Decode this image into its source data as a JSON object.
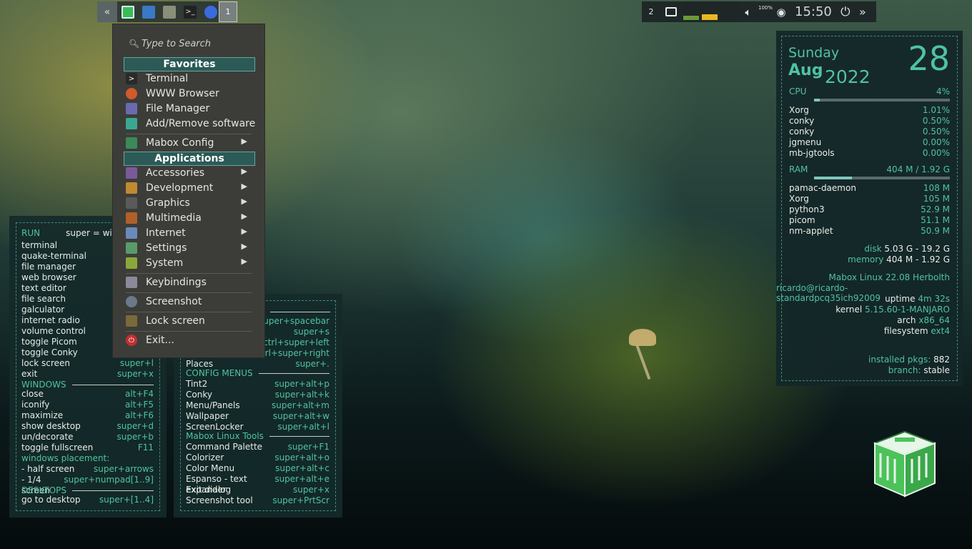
{
  "panel_left": {
    "workspace": "1"
  },
  "panel_right": {
    "desktop_num": "2",
    "volume": "100%",
    "clock": "15:50"
  },
  "menu": {
    "search_placeholder": "Type to Search",
    "favorites_header": "Favorites",
    "favorites": [
      "Terminal",
      "WWW Browser",
      "File Manager",
      "Add/Remove software"
    ],
    "mabox_config": "Mabox Config",
    "applications_header": "Applications",
    "applications": [
      "Accessories",
      "Development",
      "Graphics",
      "Multimedia",
      "Internet",
      "Settings",
      "System"
    ],
    "keybindings": "Keybindings",
    "screenshot": "Screenshot",
    "lock": "Lock screen",
    "exit": "Exit..."
  },
  "left_box": {
    "run": "RUN",
    "super_note": "super = wi",
    "items": [
      {
        "label": "terminal",
        "key": ""
      },
      {
        "label": "quake-terminal",
        "key": ""
      },
      {
        "label": "file manager",
        "key": ""
      },
      {
        "label": "web browser",
        "key": ""
      },
      {
        "label": "text editor",
        "key": ""
      },
      {
        "label": "file search",
        "key": ""
      },
      {
        "label": "galculator",
        "key": ""
      },
      {
        "label": "internet radio",
        "key": ""
      },
      {
        "label": "volume control",
        "key": ""
      },
      {
        "label": "toggle Picom",
        "key": ""
      },
      {
        "label": "toggle Conky",
        "key": ""
      },
      {
        "label": "lock screen",
        "key": "super+l"
      },
      {
        "label": "exit",
        "key": "super+x"
      }
    ],
    "windows": "WINDOWS",
    "win_items": [
      {
        "label": "close",
        "key": "alt+F4"
      },
      {
        "label": "iconify",
        "key": "alt+F5"
      },
      {
        "label": "maximize",
        "key": "alt+F6"
      },
      {
        "label": "show desktop",
        "key": "super+d"
      },
      {
        "label": "un/decorate",
        "key": "super+b"
      },
      {
        "label": "toggle fullscreen",
        "key": "F11"
      }
    ],
    "placement": "windows placement:",
    "place_items": [
      {
        "label": " - half screen",
        "key": "super+arrows"
      },
      {
        "label": " - 1/4 screen",
        "key": "super+numpad[1..9]"
      }
    ],
    "desktops": "DESKTOPS",
    "desk_items": [
      {
        "label": "go to desktop",
        "key": "super+[1..4]"
      }
    ]
  },
  "mid_box": {
    "top_items": [
      {
        "label": "",
        "key": "super+spacebar"
      },
      {
        "label": "",
        "key": "super+s"
      },
      {
        "label": "",
        "key": "ctrl+super+left"
      },
      {
        "label": "",
        "key": "ctrl+super+right"
      },
      {
        "label": "Places",
        "key": "super+."
      }
    ],
    "config": "CONFIG MENUS",
    "config_items": [
      {
        "label": "Tint2",
        "key": "super+alt+p"
      },
      {
        "label": "Conky",
        "key": "super+alt+k"
      },
      {
        "label": "Menu/Panels",
        "key": "super+alt+m"
      },
      {
        "label": "Wallpaper",
        "key": "super+alt+w"
      },
      {
        "label": "ScreenLocker",
        "key": "super+alt+l"
      }
    ],
    "tools": "Mabox Linux Tools",
    "tool_items": [
      {
        "label": "Command Palette",
        "key": "super+F1"
      },
      {
        "label": "Colorizer",
        "key": "super+alt+o"
      },
      {
        "label": "Color Menu",
        "key": "super+alt+c"
      },
      {
        "label": "Espanso - text expander",
        "key": "super+alt+e"
      },
      {
        "label": "Exit dialog",
        "key": "super+x"
      },
      {
        "label": "Screenshot tool",
        "key": "super+PrtScr"
      }
    ]
  },
  "conky": {
    "day": "Sunday",
    "month": "Aug",
    "year": "2022",
    "date": "28",
    "cpu_label": "CPU",
    "cpu_val": "4%",
    "cpu_frac": 0.04,
    "cpu_procs": [
      {
        "n": "Xorg",
        "v": "1.01%"
      },
      {
        "n": "conky",
        "v": "0.50%"
      },
      {
        "n": "conky",
        "v": "0.50%"
      },
      {
        "n": "jgmenu",
        "v": "0.00%"
      },
      {
        "n": "mb-jgtools",
        "v": "0.00%"
      }
    ],
    "ram_label": "RAM",
    "ram_val": "404 M / 1.92 G",
    "ram_frac": 0.28,
    "ram_procs": [
      {
        "n": "pamac-daemon",
        "v": "108 M"
      },
      {
        "n": "Xorg",
        "v": "105 M"
      },
      {
        "n": "python3",
        "v": "52.9 M"
      },
      {
        "n": "picom",
        "v": "51.1 M"
      },
      {
        "n": "nm-applet",
        "v": "50.9 M"
      }
    ],
    "disk_label": "disk",
    "disk_val": "5.03 G - 19.2 G",
    "mem_label": "memory",
    "mem_val": "404 M - 1.92 G",
    "distro": "Mabox Linux 22.08 Herbolth",
    "host": "ricardo@ricardo-standardpcq35ich92009",
    "uptime_label": "uptime",
    "uptime_val": "4m 32s",
    "kernel_label": "kernel",
    "kernel_val": "5.15.60-1-MANJARO",
    "arch_label": "arch",
    "arch_val": "x86_64",
    "fs_label": "filesystem",
    "fs_val": "ext4",
    "pkgs_label": "installed pkgs:",
    "pkgs_val": "882",
    "branch_label": "branch:",
    "branch_val": "stable"
  }
}
